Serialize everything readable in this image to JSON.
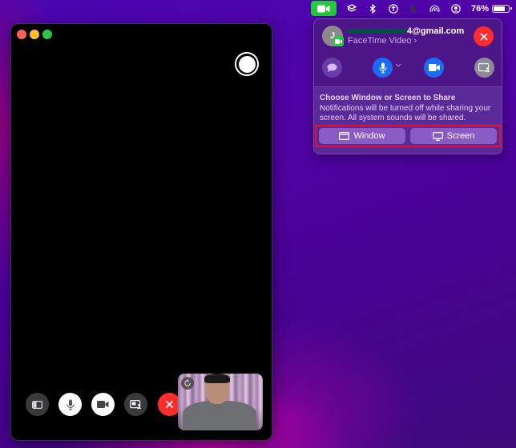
{
  "menubar": {
    "items": [
      {
        "name": "facetime-video-indicator",
        "icon": "video-camera-icon",
        "active": true,
        "color": "#27c93f"
      },
      {
        "name": "layers-menu",
        "icon": "layers-icon"
      },
      {
        "name": "bluetooth-menu",
        "icon": "bluetooth-icon"
      },
      {
        "name": "accessibility-menu",
        "icon": "accessibility-icon"
      },
      {
        "name": "focus-menu",
        "icon": "moon-icon"
      },
      {
        "name": "airdrop-menu",
        "icon": "airdrop-icon"
      },
      {
        "name": "user-menu",
        "icon": "user-circle-icon"
      }
    ],
    "battery": {
      "text": "76%",
      "level": 0.76
    }
  },
  "facetime_window": {
    "traffic_lights": [
      "close",
      "minimize",
      "zoom"
    ],
    "controls": [
      {
        "name": "sidebar-button",
        "icon": "sidebar-icon"
      },
      {
        "name": "mute-button",
        "icon": "microphone-icon"
      },
      {
        "name": "camera-button",
        "icon": "video-camera-icon"
      },
      {
        "name": "shareplay-button",
        "icon": "screen-share-icon"
      },
      {
        "name": "end-call-button",
        "icon": "close-icon",
        "color": "#ff2d2d"
      }
    ],
    "self_view": {
      "label": "Self view camera preview"
    }
  },
  "popover": {
    "avatar_initial": "J",
    "email_visible": "4@gmail.com",
    "subtitle": "FaceTime Video",
    "subtitle_chevron": "›",
    "controls": [
      {
        "name": "messages-button",
        "icon": "message-bubble-icon"
      },
      {
        "name": "microphone-button",
        "icon": "microphone-icon",
        "color": "#1a6cf5"
      },
      {
        "name": "video-button",
        "icon": "video-camera-icon",
        "color": "#1a6cf5"
      },
      {
        "name": "screen-share-button",
        "icon": "screen-share-icon"
      }
    ],
    "share": {
      "title": "Choose Window or Screen to Share",
      "description": "Notifications will be turned off while sharing your screen. All system sounds will be shared.",
      "window_label": "Window",
      "screen_label": "Screen",
      "highlight_color": "#e8102a"
    }
  }
}
